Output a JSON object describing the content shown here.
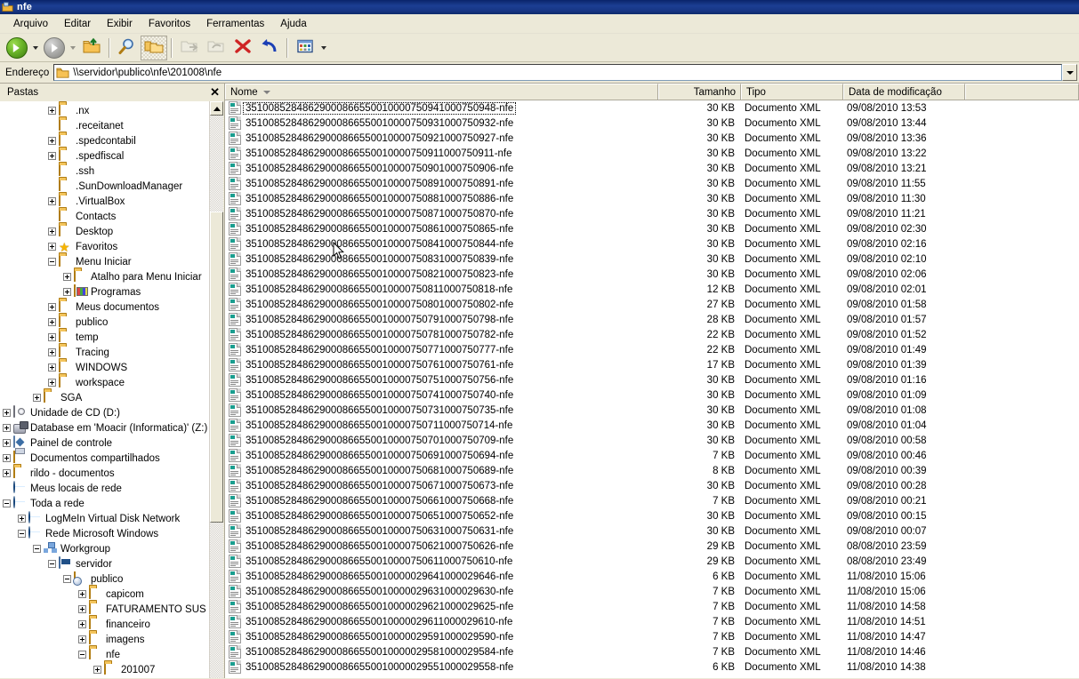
{
  "window": {
    "title": "nfe",
    "title_icon": "folder-icon"
  },
  "menu": {
    "items": [
      "Arquivo",
      "Editar",
      "Exibir",
      "Favoritos",
      "Ferramentas",
      "Ajuda"
    ]
  },
  "toolbar": {
    "buttons": [
      {
        "name": "back-button",
        "icon": "back-arrow-icon",
        "enabled": true
      },
      {
        "name": "forward-button",
        "icon": "forward-arrow-icon",
        "enabled": false
      },
      {
        "name": "up-button",
        "icon": "up-folder-icon",
        "enabled": true
      },
      {
        "name": "search-button",
        "icon": "search-icon",
        "enabled": true
      },
      {
        "name": "folders-button",
        "icon": "folders-icon",
        "enabled": true,
        "pressed": true
      },
      {
        "name": "move-to-button",
        "icon": "move-to-folder-icon",
        "enabled": false
      },
      {
        "name": "copy-to-button",
        "icon": "copy-to-folder-icon",
        "enabled": false
      },
      {
        "name": "delete-button",
        "icon": "delete-x-icon",
        "enabled": true
      },
      {
        "name": "undo-button",
        "icon": "undo-arrow-icon",
        "enabled": true
      },
      {
        "name": "views-button",
        "icon": "views-icon",
        "enabled": true
      }
    ]
  },
  "address": {
    "label": "Endereço",
    "value": "\\\\servidor\\publico\\nfe\\201008\\nfe",
    "icon": "folder-icon",
    "dropdown_icon": "chevron-down-icon"
  },
  "tree": {
    "header": "Pastas",
    "close_icon": "close-icon",
    "nodes": [
      {
        "label": ".nx",
        "indent": 4,
        "toggle": "plus",
        "icon": "folder-icon"
      },
      {
        "label": ".receitanet",
        "indent": 4,
        "toggle": "none",
        "icon": "folder-icon"
      },
      {
        "label": ".spedcontabil",
        "indent": 4,
        "toggle": "plus",
        "icon": "folder-icon"
      },
      {
        "label": ".spedfiscal",
        "indent": 4,
        "toggle": "plus",
        "icon": "folder-icon"
      },
      {
        "label": ".ssh",
        "indent": 4,
        "toggle": "none",
        "icon": "folder-icon"
      },
      {
        "label": ".SunDownloadManager",
        "indent": 4,
        "toggle": "none",
        "icon": "folder-icon"
      },
      {
        "label": ".VirtualBox",
        "indent": 4,
        "toggle": "plus",
        "icon": "folder-icon"
      },
      {
        "label": "Contacts",
        "indent": 4,
        "toggle": "none",
        "icon": "folder-icon"
      },
      {
        "label": "Desktop",
        "indent": 4,
        "toggle": "plus",
        "icon": "folder-icon"
      },
      {
        "label": "Favoritos",
        "indent": 4,
        "toggle": "plus",
        "icon": "star-icon"
      },
      {
        "label": "Menu Iniciar",
        "indent": 4,
        "toggle": "minus",
        "icon": "folder-icon"
      },
      {
        "label": "Atalho para Menu Iniciar",
        "indent": 5,
        "toggle": "plus",
        "icon": "folder-icon"
      },
      {
        "label": "Programas",
        "indent": 5,
        "toggle": "plus",
        "icon": "programs-folder-icon"
      },
      {
        "label": "Meus documentos",
        "indent": 4,
        "toggle": "plus",
        "icon": "folder-icon"
      },
      {
        "label": "publico",
        "indent": 4,
        "toggle": "plus",
        "icon": "folder-icon"
      },
      {
        "label": "temp",
        "indent": 4,
        "toggle": "plus",
        "icon": "folder-icon"
      },
      {
        "label": "Tracing",
        "indent": 4,
        "toggle": "plus",
        "icon": "folder-icon"
      },
      {
        "label": "WINDOWS",
        "indent": 4,
        "toggle": "plus",
        "icon": "folder-icon"
      },
      {
        "label": "workspace",
        "indent": 4,
        "toggle": "plus",
        "icon": "folder-icon"
      },
      {
        "label": "SGA",
        "indent": 3,
        "toggle": "plus",
        "icon": "folder-icon"
      },
      {
        "label": "Unidade de CD (D:)",
        "indent": 1,
        "toggle": "plus",
        "icon": "cd-drive-icon"
      },
      {
        "label": "Database em 'Moacir (Informatica)' (Z:)",
        "indent": 1,
        "toggle": "plus",
        "icon": "network-drive-icon"
      },
      {
        "label": "Painel de controle",
        "indent": 1,
        "toggle": "plus",
        "icon": "control-panel-icon"
      },
      {
        "label": "Documentos compartilhados",
        "indent": 1,
        "toggle": "plus",
        "icon": "shared-documents-icon"
      },
      {
        "label": "rildo - documentos",
        "indent": 1,
        "toggle": "plus",
        "icon": "folder-icon"
      },
      {
        "label": "Meus locais de rede",
        "indent": 1,
        "toggle": "none",
        "icon": "network-places-icon"
      },
      {
        "label": "Toda a rede",
        "indent": 1,
        "toggle": "minus",
        "icon": "globe-icon"
      },
      {
        "label": "LogMeIn Virtual Disk Network",
        "indent": 2,
        "toggle": "plus",
        "icon": "globe-icon"
      },
      {
        "label": "Rede Microsoft Windows",
        "indent": 2,
        "toggle": "minus",
        "icon": "globe-icon"
      },
      {
        "label": "Workgroup",
        "indent": 3,
        "toggle": "minus",
        "icon": "workgroup-icon"
      },
      {
        "label": "servidor",
        "indent": 4,
        "toggle": "minus",
        "icon": "computer-icon"
      },
      {
        "label": "publico",
        "indent": 5,
        "toggle": "minus",
        "icon": "shared-folder-icon"
      },
      {
        "label": "capicom",
        "indent": 6,
        "toggle": "plus",
        "icon": "folder-icon"
      },
      {
        "label": "FATURAMENTO SUS",
        "indent": 6,
        "toggle": "plus",
        "icon": "folder-icon"
      },
      {
        "label": "financeiro",
        "indent": 6,
        "toggle": "plus",
        "icon": "folder-icon"
      },
      {
        "label": "imagens",
        "indent": 6,
        "toggle": "plus",
        "icon": "folder-icon"
      },
      {
        "label": "nfe",
        "indent": 6,
        "toggle": "minus",
        "icon": "folder-icon"
      },
      {
        "label": "201007",
        "indent": 7,
        "toggle": "plus",
        "icon": "folder-icon"
      }
    ]
  },
  "file_list": {
    "columns": [
      {
        "key": "name",
        "label": "Nome",
        "sorted": true,
        "sort_icon": "sort-descending-icon"
      },
      {
        "key": "size",
        "label": "Tamanho"
      },
      {
        "key": "type",
        "label": "Tipo"
      },
      {
        "key": "date",
        "label": "Data de modificação"
      }
    ],
    "rows": [
      {
        "name": "35100852848629000866550010000750941000750948-nfe",
        "size": "30 KB",
        "type": "Documento XML",
        "date": "09/08/2010 13:53",
        "icon": "xml-document-icon",
        "focused": true
      },
      {
        "name": "35100852848629000866550010000750931000750932-nfe",
        "size": "30 KB",
        "type": "Documento XML",
        "date": "09/08/2010 13:44",
        "icon": "xml-document-icon"
      },
      {
        "name": "35100852848629000866550010000750921000750927-nfe",
        "size": "30 KB",
        "type": "Documento XML",
        "date": "09/08/2010 13:36",
        "icon": "xml-document-icon"
      },
      {
        "name": "35100852848629000866550010000750911000750911-nfe",
        "size": "30 KB",
        "type": "Documento XML",
        "date": "09/08/2010 13:22",
        "icon": "xml-document-icon"
      },
      {
        "name": "35100852848629000866550010000750901000750906-nfe",
        "size": "30 KB",
        "type": "Documento XML",
        "date": "09/08/2010 13:21",
        "icon": "xml-document-icon"
      },
      {
        "name": "35100852848629000866550010000750891000750891-nfe",
        "size": "30 KB",
        "type": "Documento XML",
        "date": "09/08/2010 11:55",
        "icon": "xml-document-icon"
      },
      {
        "name": "35100852848629000866550010000750881000750886-nfe",
        "size": "30 KB",
        "type": "Documento XML",
        "date": "09/08/2010 11:30",
        "icon": "xml-document-icon"
      },
      {
        "name": "35100852848629000866550010000750871000750870-nfe",
        "size": "30 KB",
        "type": "Documento XML",
        "date": "09/08/2010 11:21",
        "icon": "xml-document-icon"
      },
      {
        "name": "35100852848629000866550010000750861000750865-nfe",
        "size": "30 KB",
        "type": "Documento XML",
        "date": "09/08/2010 02:30",
        "icon": "xml-document-icon"
      },
      {
        "name": "35100852848629000866550010000750841000750844-nfe",
        "size": "30 KB",
        "type": "Documento XML",
        "date": "09/08/2010 02:16",
        "icon": "xml-document-icon"
      },
      {
        "name": "35100852848629000866550010000750831000750839-nfe",
        "size": "30 KB",
        "type": "Documento XML",
        "date": "09/08/2010 02:10",
        "icon": "xml-document-icon"
      },
      {
        "name": "35100852848629000866550010000750821000750823-nfe",
        "size": "30 KB",
        "type": "Documento XML",
        "date": "09/08/2010 02:06",
        "icon": "xml-document-icon"
      },
      {
        "name": "35100852848629000866550010000750811000750818-nfe",
        "size": "12 KB",
        "type": "Documento XML",
        "date": "09/08/2010 02:01",
        "icon": "xml-document-icon"
      },
      {
        "name": "35100852848629000866550010000750801000750802-nfe",
        "size": "27 KB",
        "type": "Documento XML",
        "date": "09/08/2010 01:58",
        "icon": "xml-document-icon"
      },
      {
        "name": "35100852848629000866550010000750791000750798-nfe",
        "size": "28 KB",
        "type": "Documento XML",
        "date": "09/08/2010 01:57",
        "icon": "xml-document-icon"
      },
      {
        "name": "35100852848629000866550010000750781000750782-nfe",
        "size": "22 KB",
        "type": "Documento XML",
        "date": "09/08/2010 01:52",
        "icon": "xml-document-icon"
      },
      {
        "name": "35100852848629000866550010000750771000750777-nfe",
        "size": "22 KB",
        "type": "Documento XML",
        "date": "09/08/2010 01:49",
        "icon": "xml-document-icon"
      },
      {
        "name": "35100852848629000866550010000750761000750761-nfe",
        "size": "17 KB",
        "type": "Documento XML",
        "date": "09/08/2010 01:39",
        "icon": "xml-document-icon"
      },
      {
        "name": "35100852848629000866550010000750751000750756-nfe",
        "size": "30 KB",
        "type": "Documento XML",
        "date": "09/08/2010 01:16",
        "icon": "xml-document-icon"
      },
      {
        "name": "35100852848629000866550010000750741000750740-nfe",
        "size": "30 KB",
        "type": "Documento XML",
        "date": "09/08/2010 01:09",
        "icon": "xml-document-icon"
      },
      {
        "name": "35100852848629000866550010000750731000750735-nfe",
        "size": "30 KB",
        "type": "Documento XML",
        "date": "09/08/2010 01:08",
        "icon": "xml-document-icon"
      },
      {
        "name": "35100852848629000866550010000750711000750714-nfe",
        "size": "30 KB",
        "type": "Documento XML",
        "date": "09/08/2010 01:04",
        "icon": "xml-document-icon"
      },
      {
        "name": "35100852848629000866550010000750701000750709-nfe",
        "size": "30 KB",
        "type": "Documento XML",
        "date": "09/08/2010 00:58",
        "icon": "xml-document-icon"
      },
      {
        "name": "35100852848629000866550010000750691000750694-nfe",
        "size": "7 KB",
        "type": "Documento XML",
        "date": "09/08/2010 00:46",
        "icon": "xml-document-icon"
      },
      {
        "name": "35100852848629000866550010000750681000750689-nfe",
        "size": "8 KB",
        "type": "Documento XML",
        "date": "09/08/2010 00:39",
        "icon": "xml-document-icon"
      },
      {
        "name": "35100852848629000866550010000750671000750673-nfe",
        "size": "30 KB",
        "type": "Documento XML",
        "date": "09/08/2010 00:28",
        "icon": "xml-document-icon"
      },
      {
        "name": "35100852848629000866550010000750661000750668-nfe",
        "size": "7 KB",
        "type": "Documento XML",
        "date": "09/08/2010 00:21",
        "icon": "xml-document-icon"
      },
      {
        "name": "35100852848629000866550010000750651000750652-nfe",
        "size": "30 KB",
        "type": "Documento XML",
        "date": "09/08/2010 00:15",
        "icon": "xml-document-icon"
      },
      {
        "name": "35100852848629000866550010000750631000750631-nfe",
        "size": "30 KB",
        "type": "Documento XML",
        "date": "09/08/2010 00:07",
        "icon": "xml-document-icon"
      },
      {
        "name": "35100852848629000866550010000750621000750626-nfe",
        "size": "29 KB",
        "type": "Documento XML",
        "date": "08/08/2010 23:59",
        "icon": "xml-document-icon"
      },
      {
        "name": "35100852848629000866550010000750611000750610-nfe",
        "size": "29 KB",
        "type": "Documento XML",
        "date": "08/08/2010 23:49",
        "icon": "xml-document-icon"
      },
      {
        "name": "35100852848629000866550010000029641000029646-nfe",
        "size": "6 KB",
        "type": "Documento XML",
        "date": "11/08/2010 15:06",
        "icon": "xml-document-icon"
      },
      {
        "name": "35100852848629000866550010000029631000029630-nfe",
        "size": "7 KB",
        "type": "Documento XML",
        "date": "11/08/2010 15:06",
        "icon": "xml-document-icon"
      },
      {
        "name": "35100852848629000866550010000029621000029625-nfe",
        "size": "7 KB",
        "type": "Documento XML",
        "date": "11/08/2010 14:58",
        "icon": "xml-document-icon"
      },
      {
        "name": "35100852848629000866550010000029611000029610-nfe",
        "size": "7 KB",
        "type": "Documento XML",
        "date": "11/08/2010 14:51",
        "icon": "xml-document-icon"
      },
      {
        "name": "35100852848629000866550010000029591000029590-nfe",
        "size": "7 KB",
        "type": "Documento XML",
        "date": "11/08/2010 14:47",
        "icon": "xml-document-icon"
      },
      {
        "name": "35100852848629000866550010000029581000029584-nfe",
        "size": "7 KB",
        "type": "Documento XML",
        "date": "11/08/2010 14:46",
        "icon": "xml-document-icon"
      },
      {
        "name": "35100852848629000866550010000029551000029558-nfe",
        "size": "6 KB",
        "type": "Documento XML",
        "date": "11/08/2010 14:38",
        "icon": "xml-document-icon"
      }
    ]
  },
  "colors": {
    "titlebar_blue": "#0a246a",
    "chrome_beige": "#ece9d8",
    "list_background": "#ffffff",
    "border_gray": "#aca899"
  }
}
